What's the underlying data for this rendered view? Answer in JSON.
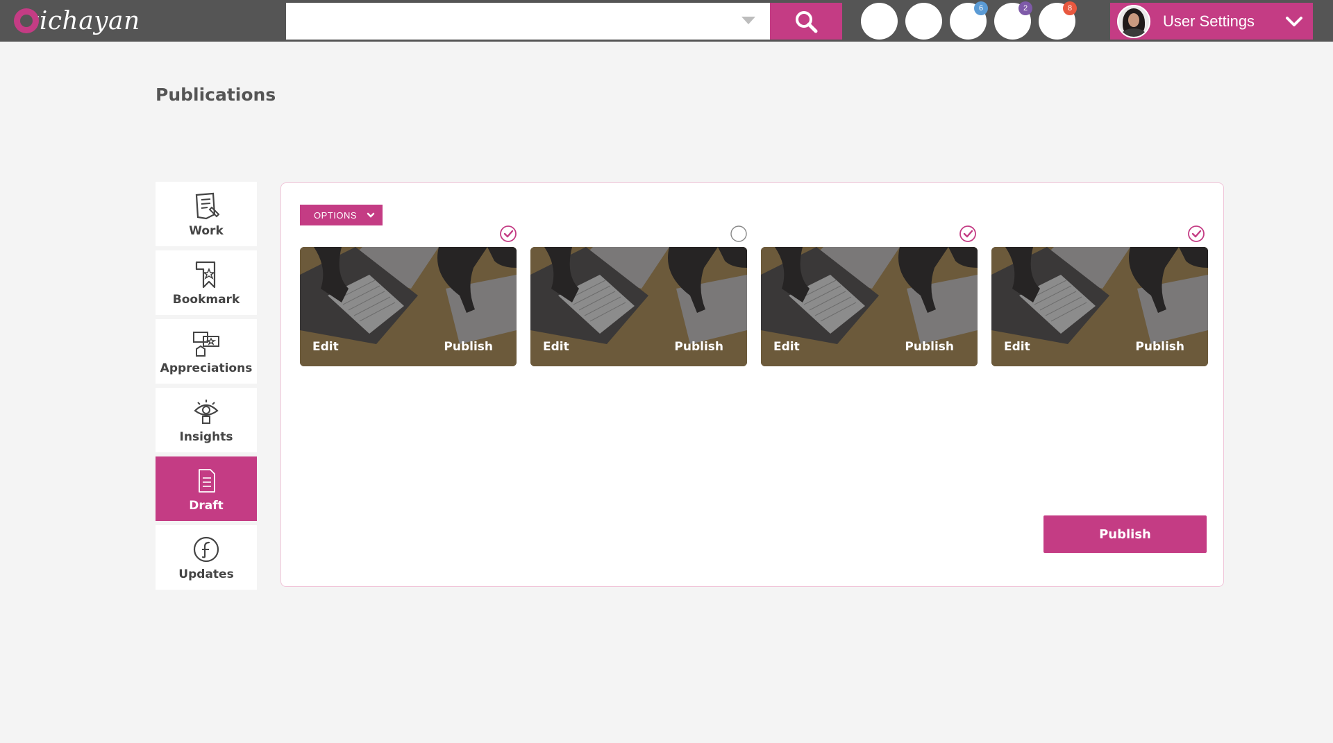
{
  "brand": {
    "logo_text": "vichayan",
    "accent_color": "#c43c84",
    "topbar_color": "#555555"
  },
  "search": {
    "placeholder": "",
    "value": ""
  },
  "header_icons": [
    {
      "name": "notification-1",
      "badge": ""
    },
    {
      "name": "notification-2",
      "badge": ""
    },
    {
      "name": "notification-3",
      "badge": "6",
      "badge_color": "#5b9bd5"
    },
    {
      "name": "notification-4",
      "badge": "2",
      "badge_color": "#7e5aa8"
    },
    {
      "name": "notification-5",
      "badge": "8",
      "badge_color": "#e8583f"
    }
  ],
  "user": {
    "label": "User Settings"
  },
  "page": {
    "title": "Publications"
  },
  "sidenav": {
    "items": [
      {
        "label": "Work",
        "icon": "work-icon",
        "active": false
      },
      {
        "label": "Bookmark",
        "icon": "bookmark-icon",
        "active": false
      },
      {
        "label": "Appreciations",
        "icon": "appreciations-icon",
        "active": false
      },
      {
        "label": "Insights",
        "icon": "insights-icon",
        "active": false
      },
      {
        "label": "Draft",
        "icon": "draft-icon",
        "active": true
      },
      {
        "label": "Updates",
        "icon": "updates-icon",
        "active": false
      }
    ]
  },
  "main": {
    "options_label": "OPTIONS",
    "cards": [
      {
        "edit_label": "Edit",
        "publish_label": "Publish",
        "selected": true
      },
      {
        "edit_label": "Edit",
        "publish_label": "Publish",
        "selected": false
      },
      {
        "edit_label": "Edit",
        "publish_label": "Publish",
        "selected": true
      },
      {
        "edit_label": "Edit",
        "publish_label": "Publish",
        "selected": true
      }
    ],
    "publish_label": "Publish"
  }
}
